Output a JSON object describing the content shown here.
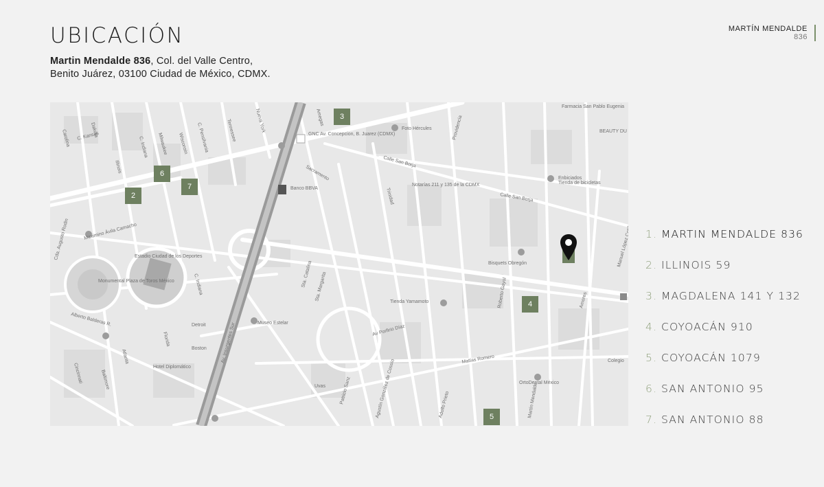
{
  "header": {
    "title": "UBICACIÓN",
    "address_bold": "Martin Mendalde 836",
    "address_rest_line1": ", Col. del Valle Centro,",
    "address_line2": "Benito Juárez, 03100 Ciudad de México, CDMX."
  },
  "brand": {
    "name": "MARTÍN MENDALDE",
    "number": "836"
  },
  "colors": {
    "marker": "#6e8060",
    "legend_number": "#8fa07c",
    "map_background": "#e9e9e9"
  },
  "map": {
    "markers": [
      "2",
      "3",
      "4",
      "5",
      "6",
      "7"
    ],
    "pin_icon": "location-pin-icon",
    "labels": {
      "l1": "Carolina",
      "l2": "C. Kansas",
      "l3": "Dakota",
      "l4": "Illinois",
      "l5": "C. Indiana",
      "l6": "Milwaukee",
      "l7": "Wisconsin",
      "l8": "C. Pensilvania",
      "l9": "Tennessee",
      "l10": "Nueva York",
      "l11": "Amegas",
      "l12": "GNC Av. Concepcion, B. Juarez (CDMX)",
      "l13": "Foto Hércules",
      "l14": "Farmacia San Pablo Eugenia",
      "l15": "BEAUTY DU",
      "l16": "Calle San Borja",
      "l17": "Banco BBVA",
      "l18": "Sacramento",
      "l19": "Notarías 211 y 135 de la CDMX",
      "l20": "Enbiciados",
      "l21": "Tienda de bicicletas",
      "l22": "Calle San Borja",
      "l23": "Providencia",
      "l24": "Cda. Augusto Rodin",
      "l25": "Maximino Ávila Camacho",
      "l26": "Estadio Ciudad de los Deportes",
      "l27": "Monumental Plaza de Toros México",
      "l28": "Av. Insurgentes Sur",
      "l29": "Bisquets Obregón",
      "l30": "Manuel López Cotilla",
      "l31": "Amores",
      "l32": "Tienda Yamamoto",
      "l33": "Museo Estelar",
      "l34": "Alberto Balderas R.",
      "l35": "Detroit",
      "l36": "Boston",
      "l37": "Av Porfirio Díaz",
      "l38": "Matías Romero",
      "l39": "Hotel Diplomático",
      "l40": "OrtoDental México",
      "l41": "Colegio",
      "l42": "Cincinnati",
      "l43": "Baltimore",
      "l44": "Atlanta",
      "l45": "Uvas",
      "l46": "Patricio Sanz",
      "l47": "Agustín González de Cossío",
      "l48": "Adolfo Prieto",
      "l49": "Martín Mendalde",
      "l50": "Roberto Gayol",
      "l51": "Florida",
      "l52": "C. Indiana",
      "l53": "Sta. Margarita",
      "l54": "Sta. Catalina",
      "l55": "Trinidad"
    }
  },
  "legend": [
    {
      "num": "1.",
      "text": "MARTIN MENDALDE 836"
    },
    {
      "num": "2.",
      "text": "ILLINOIS 59"
    },
    {
      "num": "3.",
      "text": "MAGDALENA 141 Y 132"
    },
    {
      "num": "4.",
      "text": "COYOACÁN 910"
    },
    {
      "num": "5.",
      "text": "COYOACÁN 1079"
    },
    {
      "num": "6.",
      "text": "SAN ANTONIO 95"
    },
    {
      "num": "7.",
      "text": "SAN ANTONIO 88"
    }
  ]
}
